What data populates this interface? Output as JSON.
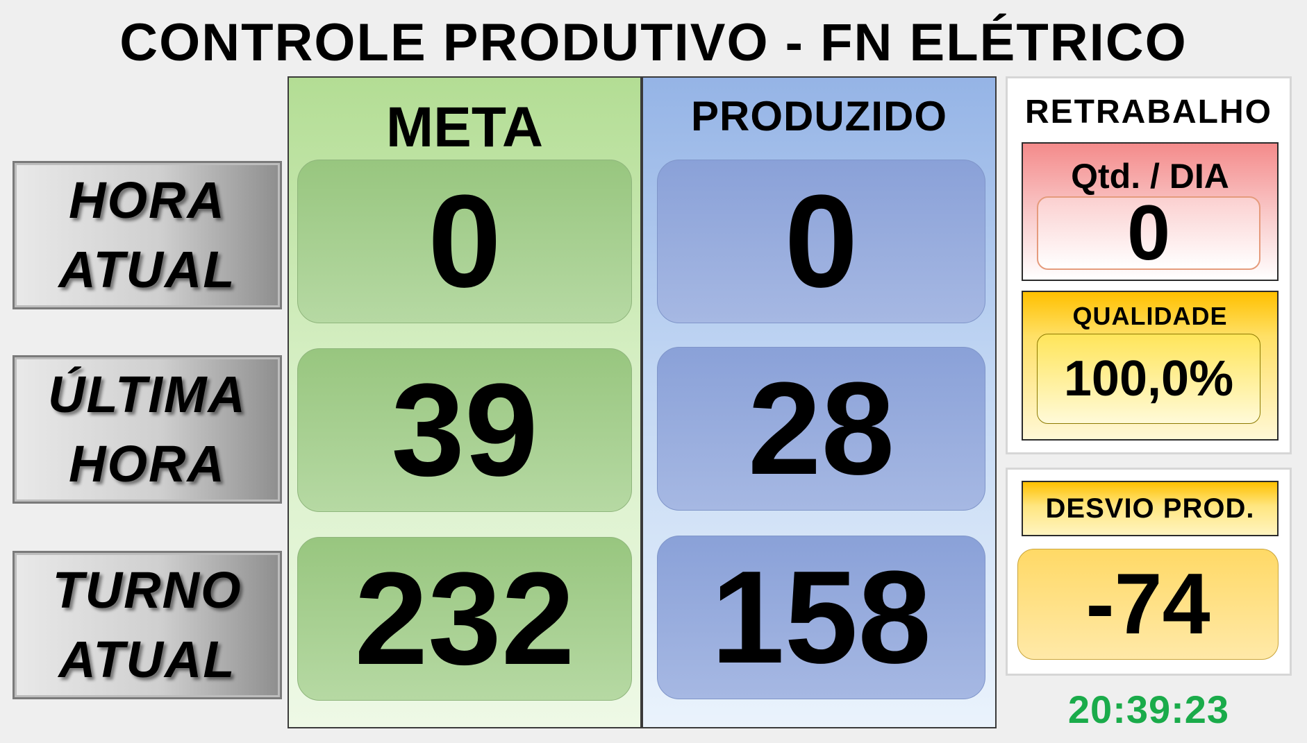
{
  "title": "CONTROLE PRODUTIVO - FN ELÉTRICO",
  "rows": [
    {
      "line1": "HORA",
      "line2": "ATUAL"
    },
    {
      "line1": "ÚLTIMA",
      "line2": "HORA"
    },
    {
      "line1": "TURNO",
      "line2": "ATUAL"
    }
  ],
  "meta": {
    "header": "META",
    "hora_atual": "0",
    "ultima_hora": "39",
    "turno_atual": "232"
  },
  "produzido": {
    "header": "PRODUZIDO",
    "hora_atual": "0",
    "ultima_hora": "28",
    "turno_atual": "158"
  },
  "retrabalho": {
    "title": "RETRABALHO",
    "qty_label": "Qtd. / DIA",
    "qty_value": "0",
    "quality_label": "QUALIDADE",
    "quality_value": "100,0%"
  },
  "desvio": {
    "label": "DESVIO PROD.",
    "value": "-74"
  },
  "clock": "20:39:23",
  "colors": {
    "meta_column": "#b3dd94",
    "produzido_column": "#95b4e6",
    "retrabalho_red": "#f48b8b",
    "quality_yellow": "#ffc000",
    "clock_green": "#1aab4a"
  }
}
